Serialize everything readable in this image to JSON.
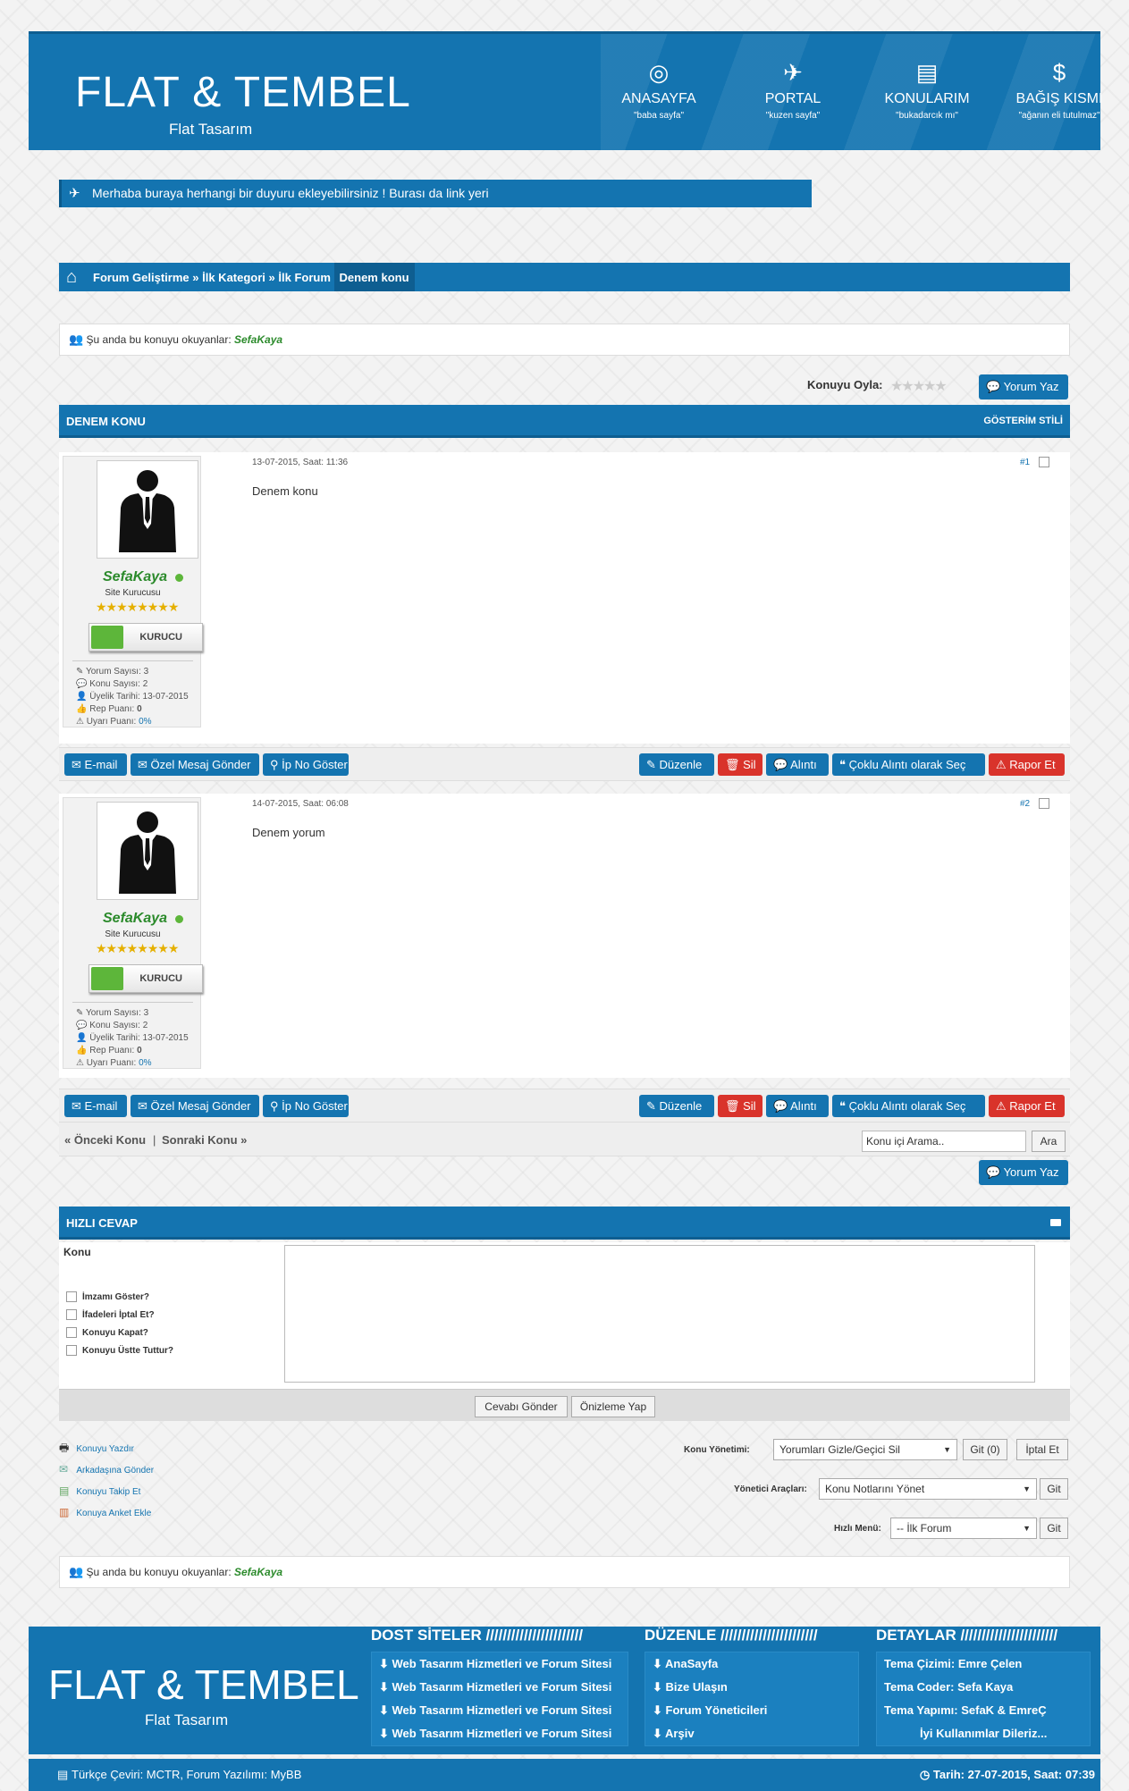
{
  "header": {
    "logo": "FLAT & TEMBEL",
    "logo_sub": "Flat Tasarım",
    "nav": [
      {
        "label": "ANASAYFA",
        "sub": "\"baba sayfa\"",
        "icon": "life-ring-icon"
      },
      {
        "label": "PORTAL",
        "sub": "\"kuzen sayfa\"",
        "icon": "paper-plane-icon"
      },
      {
        "label": "KONULARIM",
        "sub": "\"bukadarcık mı\"",
        "icon": "clipboard-icon"
      },
      {
        "label": "BAĞIŞ KISMI",
        "sub": "\"ağanın eli tutulmaz\"",
        "icon": "dollar-icon"
      }
    ]
  },
  "notice": "Merhaba buraya herhangi bir duyuru ekleyebilirsiniz ! Burası da link yeri",
  "breadcrumb": {
    "items": [
      "Forum Geliştirme",
      "İlk Kategori",
      "İlk Forum"
    ],
    "current": "Denem konu"
  },
  "viewers": {
    "label": "Şu anda bu konuyu okuyanlar:",
    "user": "SefaKaya"
  },
  "rate": {
    "label": "Konuyu Oyla:"
  },
  "reply_btn": "Yorum Yaz",
  "thread": {
    "title": "DENEM KONU",
    "style": "GÖSTERİM STİLİ"
  },
  "posts": [
    {
      "date": "13-07-2015, Saat: 11:36",
      "num": "#1",
      "body": "Denem konu"
    },
    {
      "date": "14-07-2015, Saat: 06:08",
      "num": "#2",
      "body": "Denem yorum"
    }
  ],
  "author": {
    "name": "SefaKaya",
    "title": "Site Kurucusu",
    "badge": "KURUCU",
    "stats": [
      {
        "label": "Yorum Sayısı:",
        "value": "3"
      },
      {
        "label": "Konu Sayısı:",
        "value": "2"
      },
      {
        "label": "Üyelik Tarihi:",
        "value": "13-07-2015"
      },
      {
        "label": "Rep Puanı:",
        "value": "0"
      },
      {
        "label": "Uyarı Puanı:",
        "value": "0%"
      }
    ]
  },
  "post_actions_left": [
    "E-mail",
    "Özel Mesaj Gönder",
    "İp No Göster"
  ],
  "post_actions_right": [
    "Düzenle",
    "Sil",
    "Alıntı",
    "Çoklu Alıntı olarak Seç",
    "Rapor Et"
  ],
  "nav_thread": {
    "prev": "« Önceki Konu",
    "sep": "|",
    "next": "Sonraki Konu »",
    "search_placeholder": "Konu içi Arama..",
    "search_btn": "Ara"
  },
  "quick_reply": {
    "title": "HIZLI CEVAP",
    "subject_label": "Konu",
    "options": [
      "İmzamı Göster?",
      "İfadeleri İptal Et?",
      "Konuyu Kapat?",
      "Konuyu Üstte Tuttur?"
    ],
    "submit": "Cevabı Gönder",
    "preview": "Önizleme Yap"
  },
  "tools": [
    "Konuyu Yazdır",
    "Arkadaşına Gönder",
    "Konuyu Takip Et",
    "Konuya Anket Ekle"
  ],
  "moderation": {
    "label": "Konu Yönetimi:",
    "select": "Yorumları Gizle/Geçici Sil",
    "go": "Git (0)",
    "cancel": "İptal Et",
    "admin_label": "Yönetici Araçları:",
    "admin_select": "Konu Notlarını Yönet",
    "admin_go": "Git",
    "quick_label": "Hızlı Menü:",
    "quick_select": "-- İlk Forum",
    "quick_go": "Git"
  },
  "footer": {
    "logo": "FLAT & TEMBEL",
    "logo_sub": "Flat Tasarım",
    "friends": {
      "title": "DOST SİTELER ///////////////////////",
      "items": [
        "Web Tasarım Hizmetleri ve Forum Sitesi",
        "Web Tasarım Hizmetleri ve Forum Sitesi",
        "Web Tasarım Hizmetleri ve Forum Sitesi",
        "Web Tasarım Hizmetleri ve Forum Sitesi"
      ]
    },
    "edit": {
      "title": "DÜZENLE ///////////////////////",
      "items": [
        "AnaSayfa",
        "Bize Ulaşın",
        "Forum Yöneticileri",
        "Arşiv"
      ]
    },
    "details": {
      "title": "DETAYLAR ///////////////////////",
      "items": [
        "Tema Çizimi: Emre Çelen",
        "Tema Coder: Sefa Kaya",
        "Tema Yapımı: SefaK & EmreÇ",
        "İyi Kullanımlar Dileriz..."
      ]
    },
    "credit": "Türkçe Çeviri: MCTR, Forum Yazılımı: MyBB",
    "date": "Tarih: 27-07-2015, Saat: 07:39"
  },
  "colors": {
    "brand": "#1474b0",
    "danger": "#d9332b",
    "online": "#5db63a"
  }
}
